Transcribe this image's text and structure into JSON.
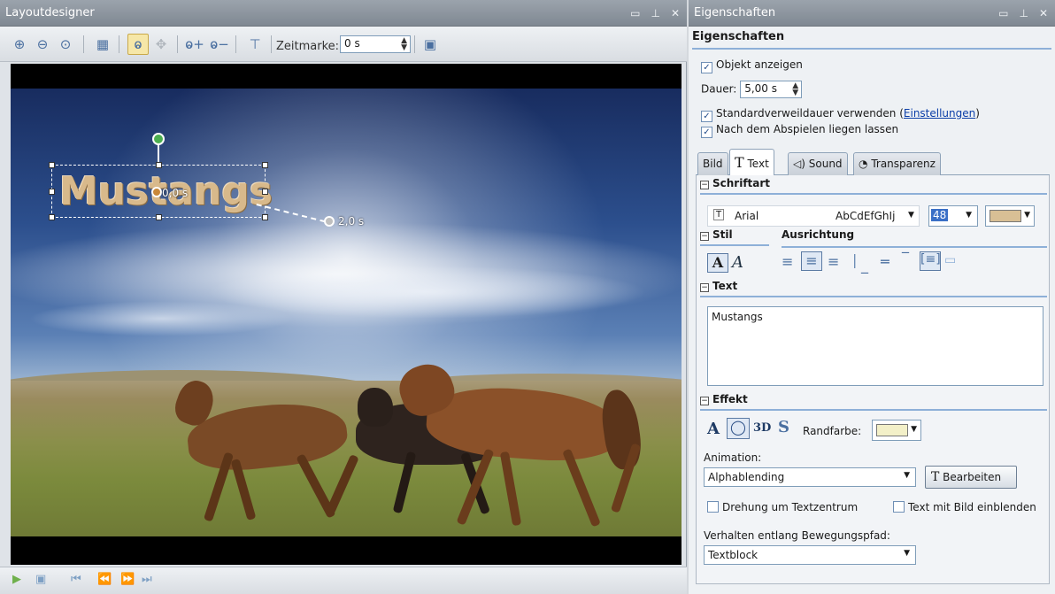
{
  "layoutdesigner": {
    "title": "Layoutdesigner",
    "toolbar": {
      "zeitmarke_label": "Zeitmarke:",
      "zeitmarke_value": "0 s"
    },
    "overlay": {
      "text": "Mustangs",
      "start_label": "0,0 s",
      "end_label": "2,0 s"
    }
  },
  "properties": {
    "title": "Eigenschaften",
    "header": "Eigenschaften",
    "objekt_anzeigen": "Objekt anzeigen",
    "dauer_label": "Dauer:",
    "dauer_value": "5,00 s",
    "standard_label": "Standardverweildauer verwenden (",
    "standard_link": "Einstellungen",
    "standard_close": ")",
    "liegen_label": "Nach dem Abspielen liegen lassen",
    "tabs": [
      "Bild",
      "Text",
      "Sound",
      "Transparenz"
    ],
    "sections": {
      "schriftart": "Schriftart",
      "stil": "Stil",
      "ausrichtung": "Ausrichtung",
      "text": "Text",
      "effekt": "Effekt"
    },
    "font": {
      "name": "Arial",
      "preview": "AbCdEfGhIj",
      "size": "48",
      "color": "#d8bf95"
    },
    "text_value": "Mustangs",
    "randfarbe_label": "Randfarbe:",
    "randfarbe_color": "#f3f0c8",
    "effekt_3d": "3D",
    "animation_label": "Animation:",
    "animation_value": "Alphablending",
    "bearbeiten_label": "Bearbeiten",
    "drehung_label": "Drehung um Textzentrum",
    "text_mit_bild_label": "Text mit Bild einblenden",
    "verhalten_label": "Verhalten entlang Bewegungspfad:",
    "verhalten_value": "Textblock"
  }
}
